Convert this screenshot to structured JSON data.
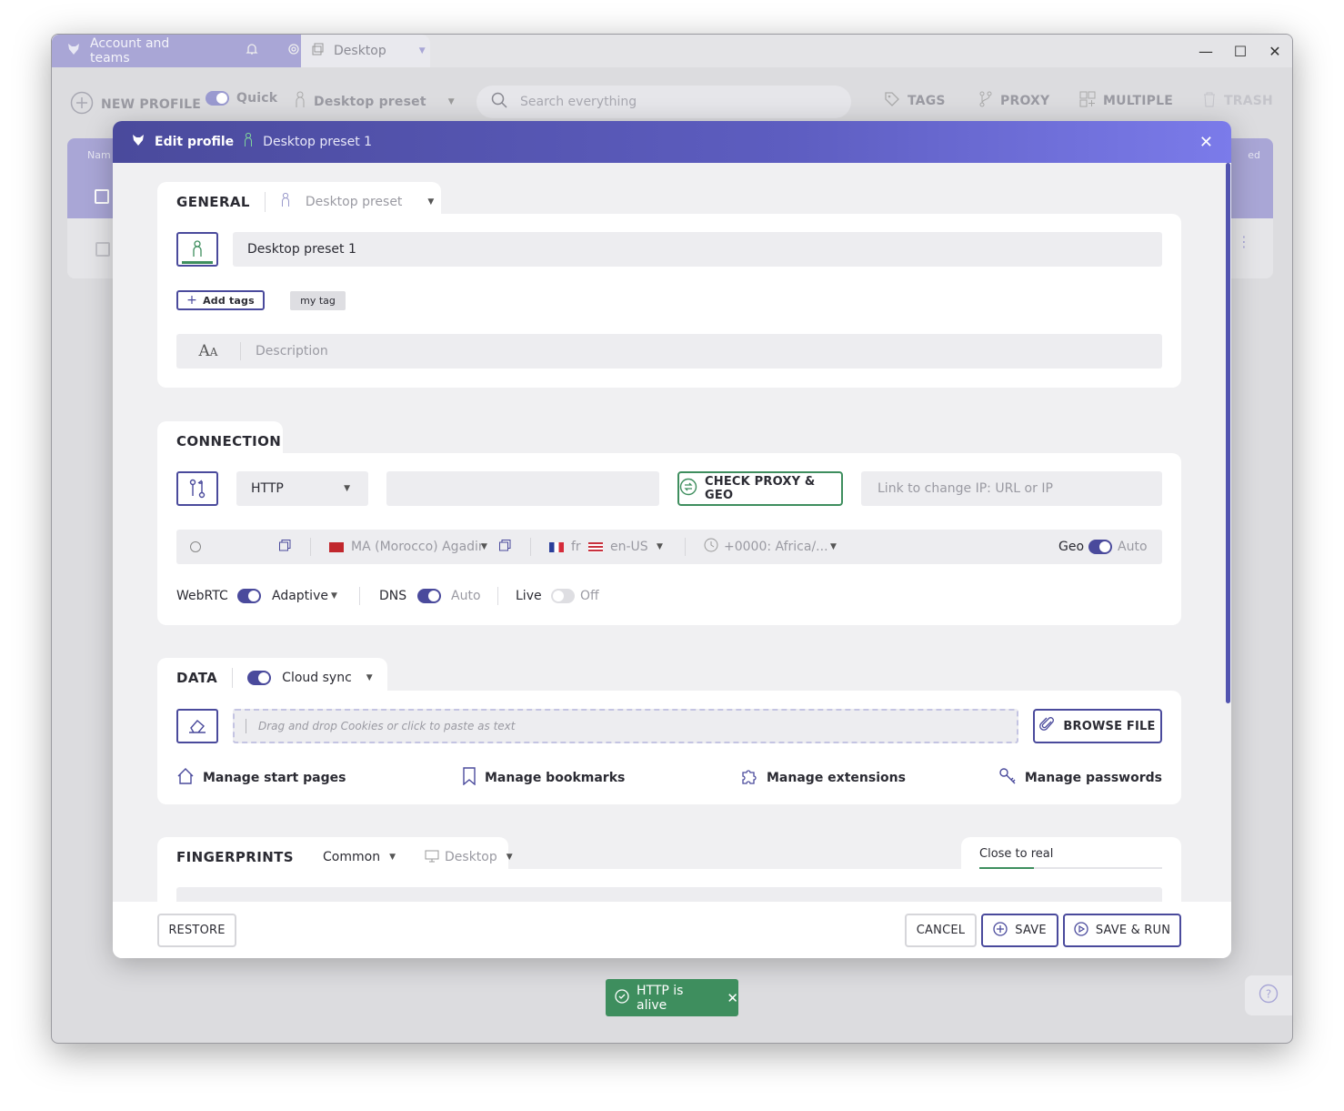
{
  "titlebar": {
    "account_tab": "Account and teams",
    "desktop_tab": "Desktop"
  },
  "toolbar": {
    "new_profile": "NEW PROFILE",
    "quick": "Quick",
    "preset": "Desktop preset",
    "search_placeholder": "Search everything",
    "tags": "TAGS",
    "proxy": "PROXY",
    "multiple": "MULTIPLE",
    "trash": "TRASH"
  },
  "bg_table": {
    "name_col": "Nam",
    "right_col": "ed"
  },
  "modal": {
    "title": "Edit profile",
    "preset_name": "Desktop preset 1",
    "general": {
      "title": "GENERAL",
      "preset": "Desktop preset",
      "profile_name": "Desktop preset 1",
      "add_tags": "Add tags",
      "tag": "my tag",
      "description_placeholder": "Description"
    },
    "connection": {
      "title": "CONNECTION",
      "proxy_type": "HTTP",
      "check_button": "CHECK PROXY & GEO",
      "change_ip_placeholder": "Link to change IP: URL or IP",
      "location": "MA (Morocco) Agadir",
      "lang_primary": "fr",
      "lang_secondary": "en-US",
      "timezone": "+0000: Africa/...",
      "geo_label": "Geo",
      "geo_value": "Auto",
      "webrtc_label": "WebRTC",
      "webrtc_value": "Adaptive",
      "dns_label": "DNS",
      "dns_value": "Auto",
      "live_label": "Live",
      "live_value": "Off"
    },
    "data": {
      "title": "DATA",
      "cloud_sync": "Cloud sync",
      "cookies_placeholder": "Drag and drop Cookies or click to paste as text",
      "browse_button": "BROWSE FILE",
      "start_pages": "Manage start pages",
      "bookmarks": "Manage bookmarks",
      "extensions": "Manage extensions",
      "passwords": "Manage passwords"
    },
    "fingerprints": {
      "title": "FINGERPRINTS",
      "mode": "Common",
      "device": "Desktop",
      "close_to_real": "Close to real",
      "close_to_real_fraction": 0.3
    },
    "footer": {
      "restore": "RESTORE",
      "cancel": "CANCEL",
      "save": "SAVE",
      "save_run": "SAVE & RUN"
    }
  },
  "toast": {
    "text": "HTTP is alive"
  },
  "colors": {
    "accent": "#4a4a9c",
    "success": "#3e8e5e",
    "header_start": "#4a4a9c",
    "header_end": "#7b7bea"
  }
}
